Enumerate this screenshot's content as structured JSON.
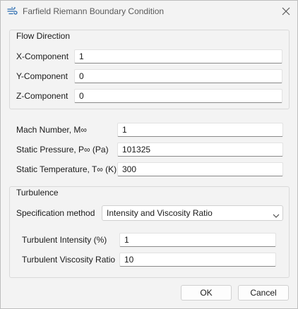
{
  "dialog": {
    "title": "Farfield Riemann Boundary Condition",
    "icon": "wind-icon"
  },
  "flow_direction": {
    "title": "Flow Direction",
    "x_label": "X-Component",
    "x_value": "1",
    "y_label": "Y-Component",
    "y_value": "0",
    "z_label": "Z-Component",
    "z_value": "0"
  },
  "freestream": {
    "mach_label": "Mach Number, M∞",
    "mach_value": "1",
    "pressure_label": "Static Pressure, P∞ (Pa)",
    "pressure_value": "101325",
    "temperature_label": "Static Temperature, T∞ (K)",
    "temperature_value": "300"
  },
  "turbulence": {
    "title": "Turbulence",
    "spec_label": "Specification method",
    "spec_value": "Intensity and Viscosity Ratio",
    "intensity_label": "Turbulent Intensity (%)",
    "intensity_value": "1",
    "viscosity_label": "Turbulent Viscosity Ratio",
    "viscosity_value": "10"
  },
  "buttons": {
    "ok": "OK",
    "cancel": "Cancel"
  },
  "colors": {
    "background": "#f3f3f3",
    "field_underline": "#8a8a8a",
    "icon": "#2b6cb0"
  }
}
